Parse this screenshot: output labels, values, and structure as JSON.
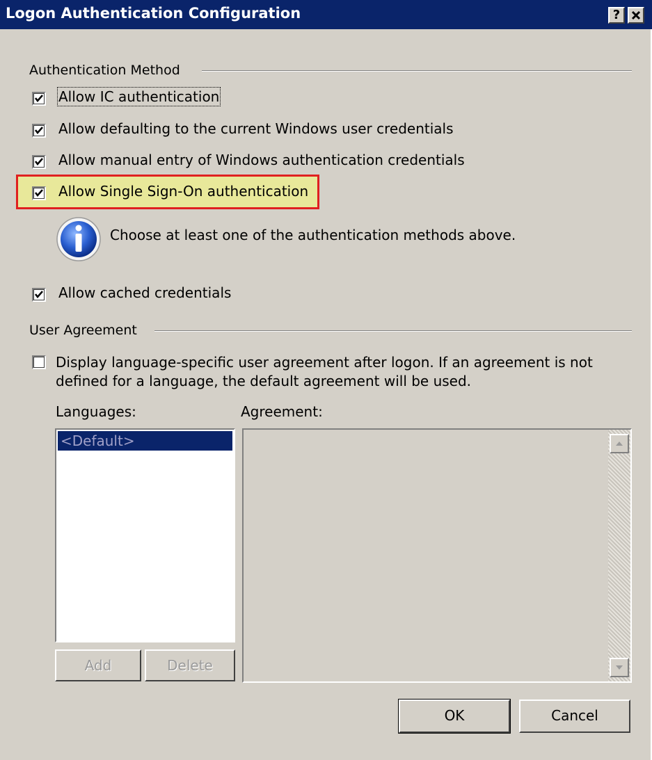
{
  "window": {
    "title": "Logon Authentication Configuration",
    "help_label": "?",
    "close_label": "✕"
  },
  "auth_method": {
    "group_label": "Authentication Method",
    "options": [
      {
        "label": "Allow IC authentication",
        "checked": true
      },
      {
        "label": "Allow defaulting to the current Windows user credentials",
        "checked": true
      },
      {
        "label": "Allow manual entry of Windows authentication credentials",
        "checked": true
      },
      {
        "label": "Allow Single Sign-On authentication",
        "checked": true
      }
    ],
    "info_text": "Choose at least one of the authentication methods above.",
    "cached": {
      "label": "Allow cached credentials",
      "checked": true
    }
  },
  "user_agreement": {
    "group_label": "User Agreement",
    "display_option": {
      "label": "Display language-specific user agreement after logon.  If an agreement is not defined for a language, the default agreement will be used.",
      "checked": false
    },
    "languages_label": "Languages:",
    "agreement_label": "Agreement:",
    "languages": [
      "<Default>"
    ],
    "add_label": "Add",
    "delete_label": "Delete"
  },
  "footer": {
    "ok_label": "OK",
    "cancel_label": "Cancel"
  },
  "colors": {
    "titlebar": "#0a246a",
    "dialog_bg": "#d4d0c8",
    "highlight_bg": "#e8e89a",
    "highlight_border": "#e02020"
  }
}
